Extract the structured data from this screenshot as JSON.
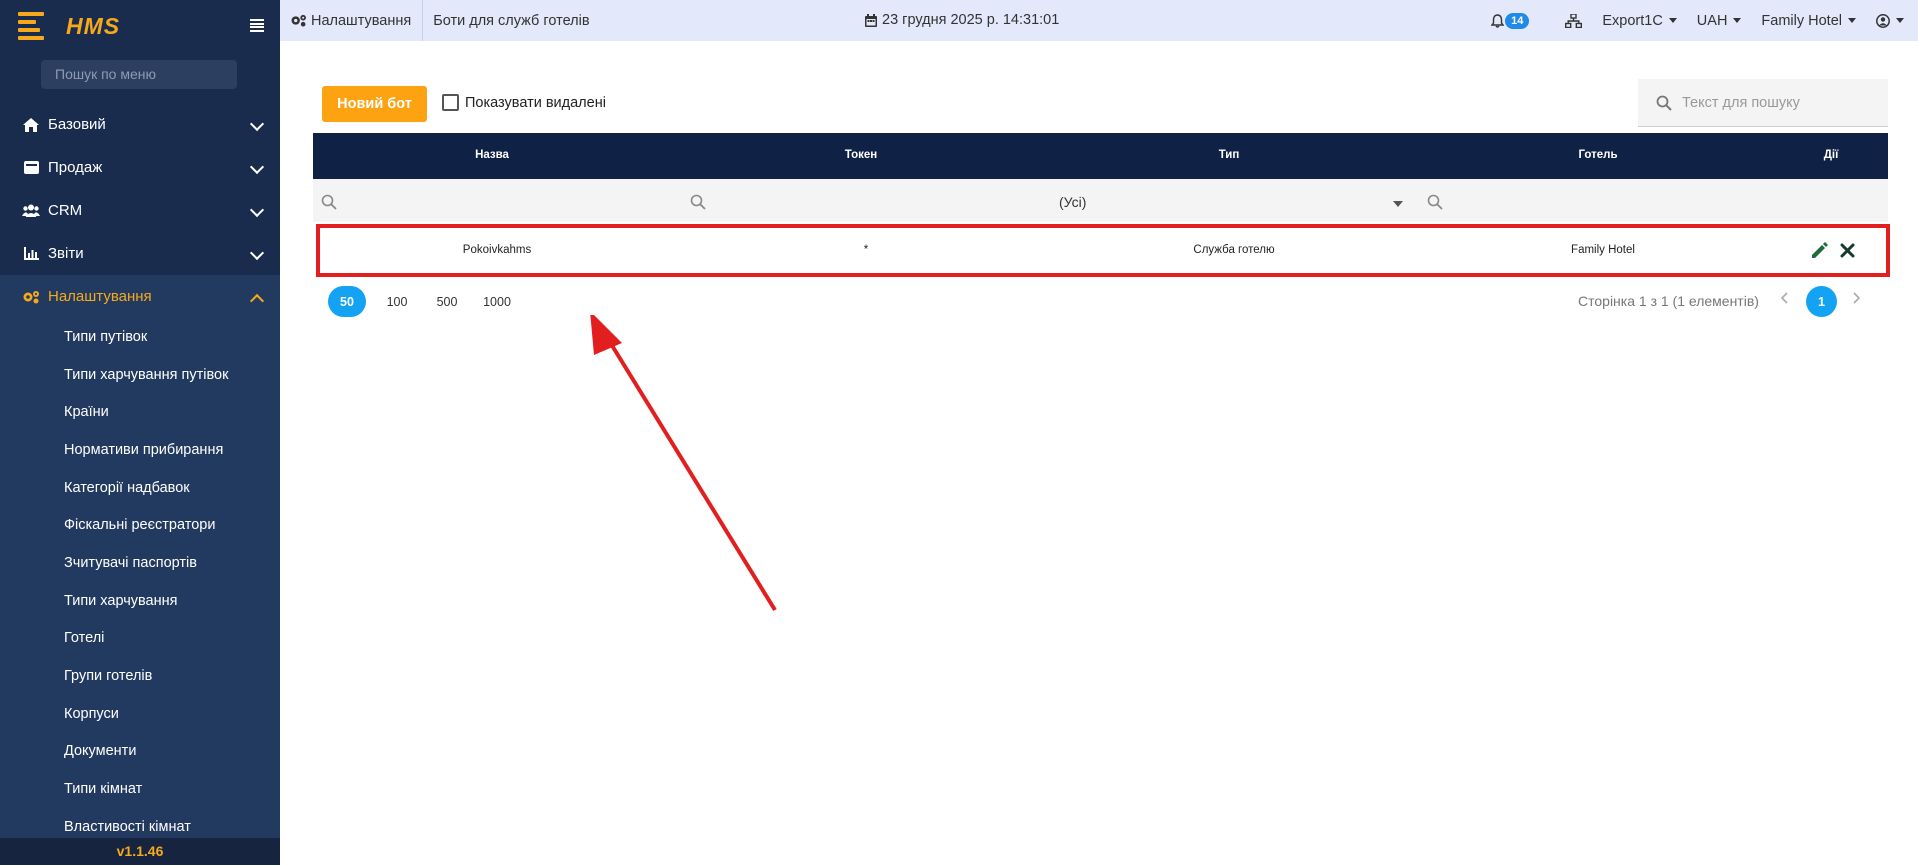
{
  "sidebar": {
    "logo": "HMS",
    "search_placeholder": "Пошук по меню",
    "menu": [
      {
        "label": "Базовий",
        "icon": "home-icon"
      },
      {
        "label": "Продаж",
        "icon": "wallet-icon"
      },
      {
        "label": "CRM",
        "icon": "users-icon"
      },
      {
        "label": "Звіти",
        "icon": "bar-chart-icon"
      },
      {
        "label": "Налаштування",
        "icon": "gears-icon"
      }
    ],
    "submenu": [
      "Типи путівок",
      "Типи харчування путівок",
      "Країни",
      "Нормативи прибирання",
      "Категорії надбавок",
      "Фіскальні реєстратори",
      "Зчитувачі паспортів",
      "Типи харчування",
      "Готелі",
      "Групи готелів",
      "Корпуси",
      "Документи",
      "Типи кімнат",
      "Властивості кімнат"
    ],
    "version": "v1.1.46"
  },
  "topbar": {
    "breadcrumb_section": "Налаштування",
    "breadcrumb_page": "Боти для служб готелів",
    "datetime": "23 грудня 2025 р. 14:31:01",
    "notifications": "14",
    "export": "Export1C",
    "currency": "UAH",
    "hotel": "Family Hotel"
  },
  "toolbar": {
    "new_bot": "Новий бот",
    "show_deleted": "Показувати видалені",
    "search_placeholder": "Текст для пошуку"
  },
  "grid": {
    "columns": [
      "Назва",
      "Токен",
      "Тип",
      "Готель",
      "Дії"
    ],
    "type_filter": "(Усі)",
    "rows": [
      {
        "name": "Pokoivkahms",
        "token": "*",
        "type": "Служба готелю",
        "hotel": "Family Hotel"
      }
    ]
  },
  "pager": {
    "sizes": [
      "50",
      "100",
      "500",
      "1000"
    ],
    "info": "Сторінка 1 з 1 (1 елементів)",
    "current": "1"
  },
  "colors": {
    "sidebar_bg": "#1a2c4e",
    "accent": "#f5a91b",
    "grid_header": "#0f2246",
    "highlight": "#e31e1e",
    "pager_active": "#14a3f2"
  }
}
